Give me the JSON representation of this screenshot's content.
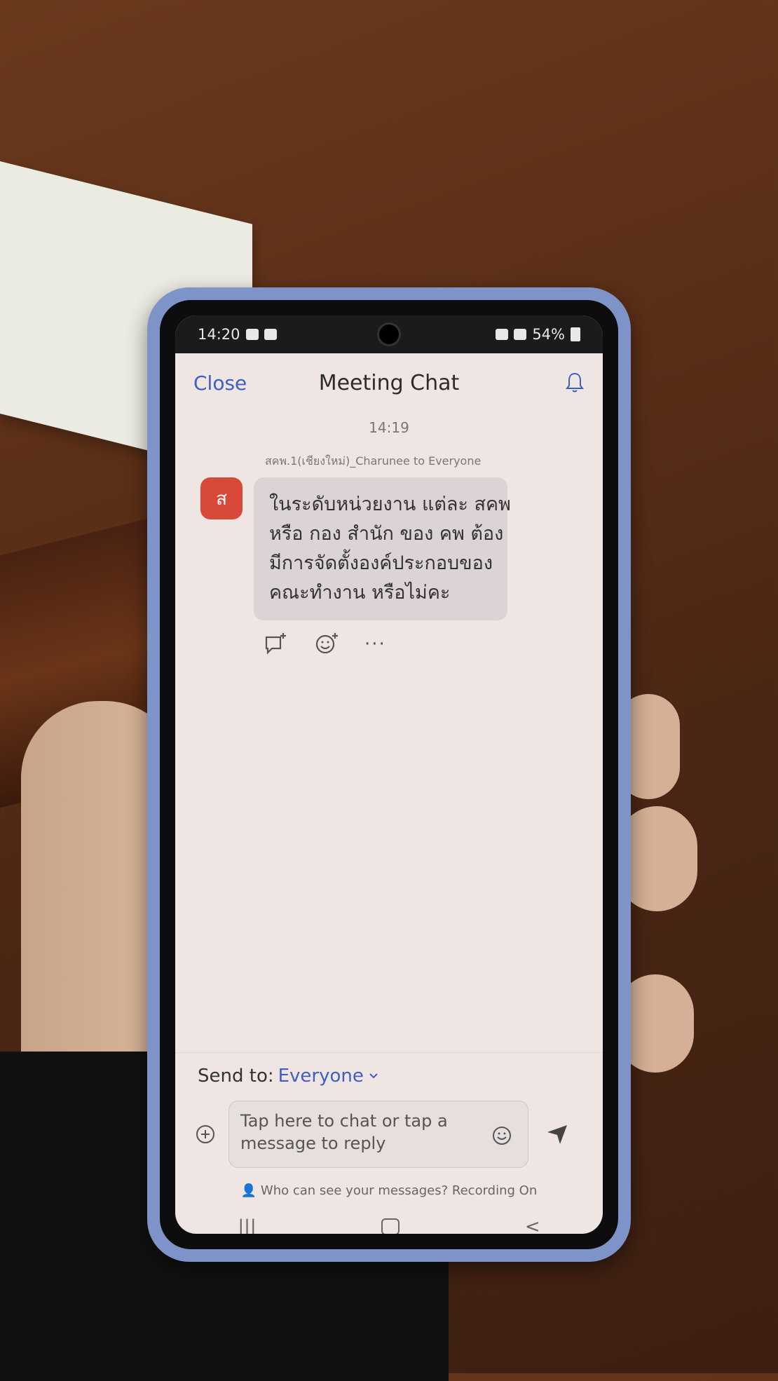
{
  "status": {
    "time": "14:20",
    "battery": "54%"
  },
  "header": {
    "close_label": "Close",
    "title": "Meeting Chat"
  },
  "chat": {
    "timestamp": "14:19",
    "message": {
      "sender": "สคพ.1(เชียงใหม่)_Charunee to Everyone",
      "avatar_letter": "ส",
      "lines": [
        "ในระดับหน่วยงาน แต่ละ สคพ",
        "หรือ กอง สำนัก ของ คพ ต้อง",
        "มีการจัดตั้งองค์ประกอบของ",
        "คณะทำงาน หรือไม่คะ"
      ]
    },
    "more_label": "···"
  },
  "composer": {
    "send_to_label": "Send to:",
    "send_to_value": "Everyone",
    "placeholder_line1": "Tap here to chat or tap a",
    "placeholder_line2": "message to reply",
    "privacy_note": "Who can see your messages? Recording On"
  },
  "navbar": {
    "back": "<",
    "recents": "|||"
  },
  "colors": {
    "accent": "#3f5ec2",
    "avatar": "#d9493a",
    "phone_case": "#7e93c7"
  }
}
